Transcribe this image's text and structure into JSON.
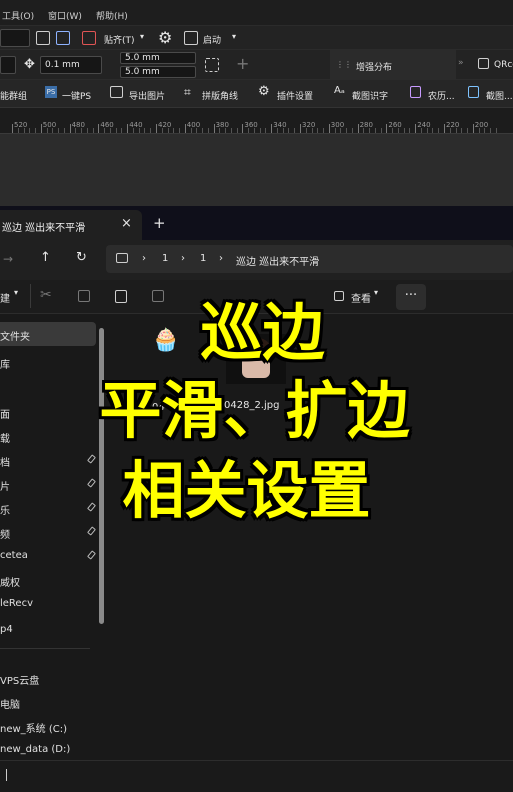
{
  "editor": {
    "menu": [
      "工具(O)",
      "窗口(W)",
      "帮助(H)"
    ],
    "toolbar1": {
      "snap_label": "贴齐(T)",
      "launch_label": "启动"
    },
    "toolbar2": {
      "nudge": "0.1 mm",
      "dup_x": "5.0 mm",
      "dup_y": "5.0 mm",
      "panel_label": "增强分布",
      "qr_label": "QRco"
    },
    "toolbar3": [
      "能群组",
      "一键PS",
      "导出图片",
      "拼版角线",
      "插件设置",
      "截图识字",
      "农历...",
      "截图..."
    ],
    "ruler": [
      "520",
      "500",
      "480",
      "460",
      "440",
      "420",
      "400",
      "380",
      "360",
      "340",
      "320",
      "300",
      "280",
      "260",
      "240",
      "220",
      "200"
    ]
  },
  "explorer": {
    "tab_title": "巡边 巡出来不平滑",
    "breadcrumb": [
      "1",
      "1",
      "巡边 巡出来不平滑"
    ],
    "view_label": "查看",
    "new_label": "建",
    "sidebar": [
      "文件夹",
      "库",
      "面",
      "载",
      "档",
      "片",
      "乐",
      "频",
      "cetea",
      "威权",
      "leRecv",
      "p4",
      "VPS云盘",
      "电脑",
      "new_系统 (C:)",
      "new_data (D:)"
    ],
    "files": [
      {
        "name": "04"
      },
      {
        "name": "0428_2.jpg"
      }
    ]
  },
  "overlay": {
    "line1": "巡边",
    "line2": "平滑、扩边",
    "line3": "相关设置"
  },
  "colors": {
    "overlay_text": "#ffff00",
    "overlay_stroke": "#000000",
    "selected_folder": "#3a3a3a"
  }
}
